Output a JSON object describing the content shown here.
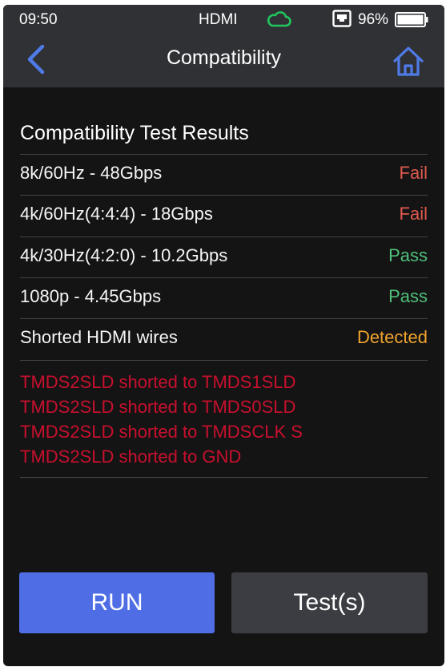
{
  "status_bar": {
    "time": "09:50",
    "source": "HDMI",
    "battery": "96%",
    "icons": [
      "cloud-icon",
      "network-port-icon",
      "battery-icon"
    ]
  },
  "header": {
    "title": "Compatibility",
    "back_icon": "back-arrow-icon",
    "home_icon": "home-icon"
  },
  "results": {
    "section_title": "Compatibility Test Results",
    "rows": [
      {
        "label": "8k/60Hz - 48Gbps",
        "result": "Fail"
      },
      {
        "label": "4k/60Hz(4:4:4) - 18Gbps",
        "result": "Fail"
      },
      {
        "label": "4k/30Hz(4:2:0) - 10.2Gbps",
        "result": "Pass"
      },
      {
        "label": "1080p - 4.45Gbps",
        "result": "Pass"
      },
      {
        "label": "Shorted HDMI wires",
        "result": "Detected"
      }
    ],
    "errors": [
      "TMDS2SLD shorted to TMDS1SLD",
      "TMDS2SLD shorted to TMDS0SLD",
      "TMDS2SLD shorted to TMDSCLK S",
      "TMDS2SLD shorted to GND"
    ]
  },
  "buttons": {
    "run": "RUN",
    "tests": "Test(s)"
  },
  "colors": {
    "fail": "#e05a4f",
    "pass": "#4fbf7a",
    "detected": "#f0a32e",
    "error_text": "#c8102e",
    "accent": "#4f6ee6",
    "cloud": "#22c55e"
  }
}
